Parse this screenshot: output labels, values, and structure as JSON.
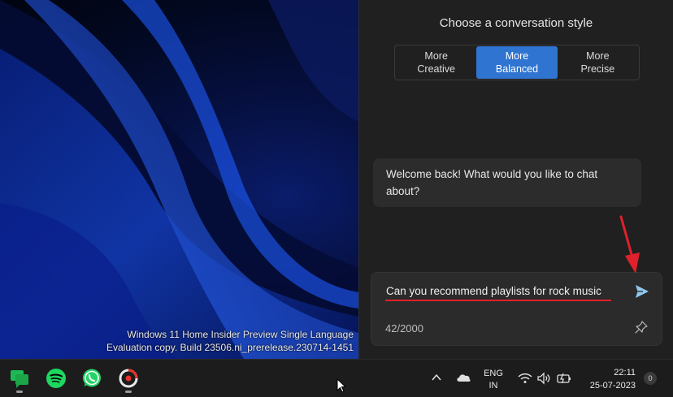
{
  "desktop": {
    "watermark_line1": "Windows 11 Home Insider Preview Single Language",
    "watermark_line2": "Evaluation copy. Build 23506.ni_prerelease.230714-1451"
  },
  "copilot": {
    "style_title": "Choose a conversation style",
    "styles": [
      {
        "line1": "More",
        "line2": "Creative",
        "active": false
      },
      {
        "line1": "More",
        "line2": "Balanced",
        "active": true
      },
      {
        "line1": "More",
        "line2": "Precise",
        "active": false
      }
    ],
    "welcome_message": "Welcome back! What would you like to chat about?",
    "input_value": "Can you recommend playlists for rock music",
    "char_counter": "42/2000",
    "accent_color": "#2f74d0",
    "annotation_color": "#e0202a"
  },
  "taskbar": {
    "apps": [
      "chat-icon",
      "spotify-icon",
      "whatsapp-icon",
      "recorder-icon"
    ],
    "language_line1": "ENG",
    "language_line2": "IN",
    "time": "22:11",
    "date": "25-07-2023",
    "notification_count": "0"
  }
}
